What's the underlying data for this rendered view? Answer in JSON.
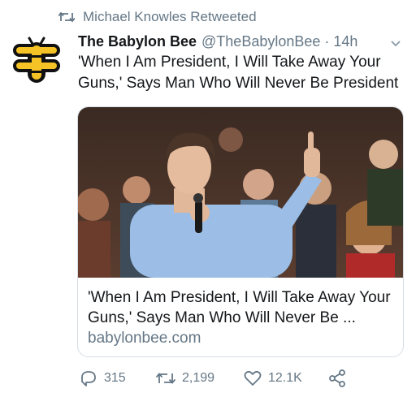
{
  "retweet": {
    "label": "Michael Knowles Retweeted",
    "icon": "retweet-icon"
  },
  "tweet": {
    "display_name": "The Babylon Bee",
    "handle": "@TheBabylonBee",
    "separator": "·",
    "time": "14h",
    "text": "'When I Am President, I Will Take Away Your Guns,' Says Man Who Will Never Be President",
    "avatar_icon": "babylon-bee-logo"
  },
  "card": {
    "title": "'When I Am President, I Will Take Away Your Guns,' Says Man Who Will Never Be ...",
    "domain": "babylonbee.com",
    "image": "photo of a man speaking into a microphone with a raised finger in front of a crowd"
  },
  "actions": {
    "replies": "315",
    "retweets": "2,199",
    "likes": "12.1K"
  },
  "colors": {
    "text": "#14171a",
    "secondary": "#657786",
    "border": "#d6dde3",
    "bee_yellow": "#f5c325"
  }
}
